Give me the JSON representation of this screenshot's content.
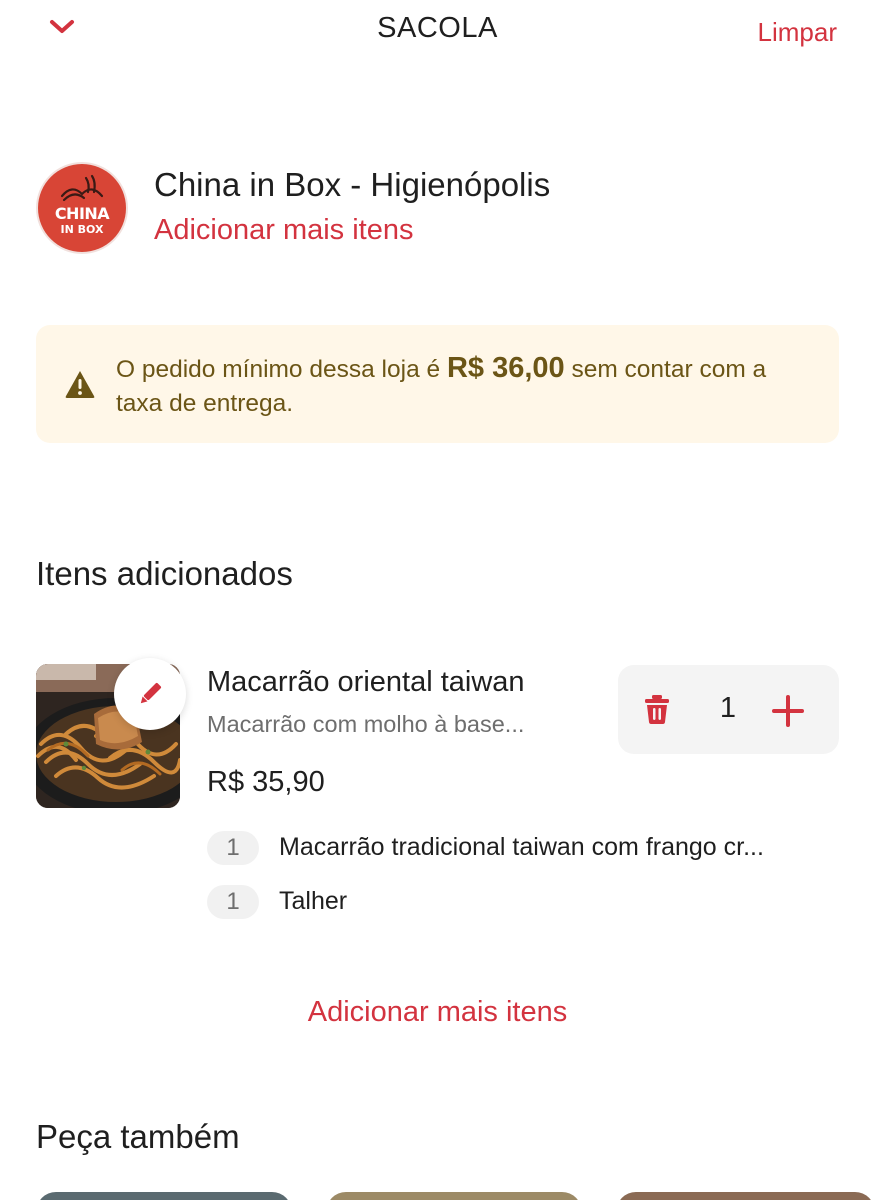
{
  "header": {
    "title": "SACOLA",
    "clear_label": "Limpar"
  },
  "store": {
    "name": "China in Box - Higienópolis",
    "add_more_label": "Adicionar mais itens",
    "logo_text_line1": "CHINA",
    "logo_text_line2": "IN BOX"
  },
  "warning": {
    "text_before": "O pedido mínimo dessa loja é ",
    "amount": "R$ 36,00",
    "text_after": " sem contar com a taxa de entrega."
  },
  "added_items": {
    "title": "Itens adicionados",
    "items": [
      {
        "name": "Macarrão oriental taiwan",
        "description": "Macarrão com molho à base...",
        "price": "R$ 35,90",
        "quantity": "1",
        "options": [
          {
            "qty": "1",
            "label": "Macarrão tradicional taiwan com frango cr..."
          },
          {
            "qty": "1",
            "label": "Talher"
          }
        ]
      }
    ],
    "add_more_label": "Adicionar mais itens"
  },
  "suggestions": {
    "title": "Peça também"
  },
  "colors": {
    "accent": "#d3333f",
    "warning_bg": "#fff7e8",
    "warning_text": "#6b5516"
  },
  "icons": {
    "back": "chevron-down-icon",
    "warning": "warning-triangle-icon",
    "edit": "pencil-icon",
    "trash": "trash-icon",
    "plus": "plus-icon"
  }
}
